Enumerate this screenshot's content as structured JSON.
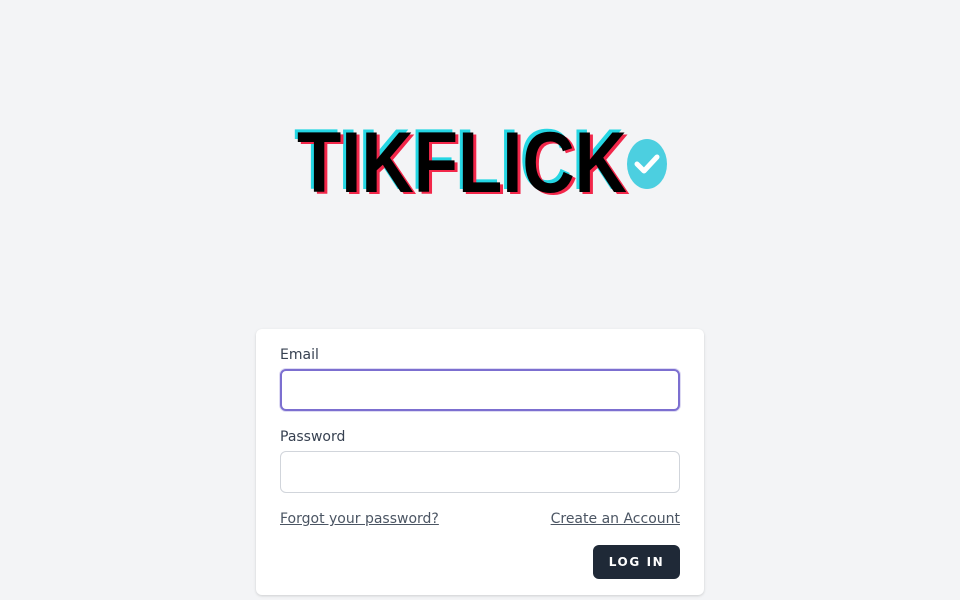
{
  "brand": {
    "logo_text": "TIKFLICK",
    "verified_badge_icon": "check-badge-icon",
    "colors": {
      "text": "#000000",
      "cyan": "#25d6e3",
      "red": "#f2274a",
      "badge": "#4ccfe0"
    }
  },
  "login_form": {
    "email_label": "Email",
    "email_value": "",
    "email_placeholder": "",
    "password_label": "Password",
    "password_value": "",
    "password_placeholder": "",
    "forgot_password_link": "Forgot your password?",
    "create_account_link": "Create an Account",
    "login_button": "LOG IN"
  },
  "colors": {
    "background": "#f3f4f6",
    "card": "#ffffff",
    "focus_ring": "#7c6fd0",
    "button": "#1f2937"
  }
}
